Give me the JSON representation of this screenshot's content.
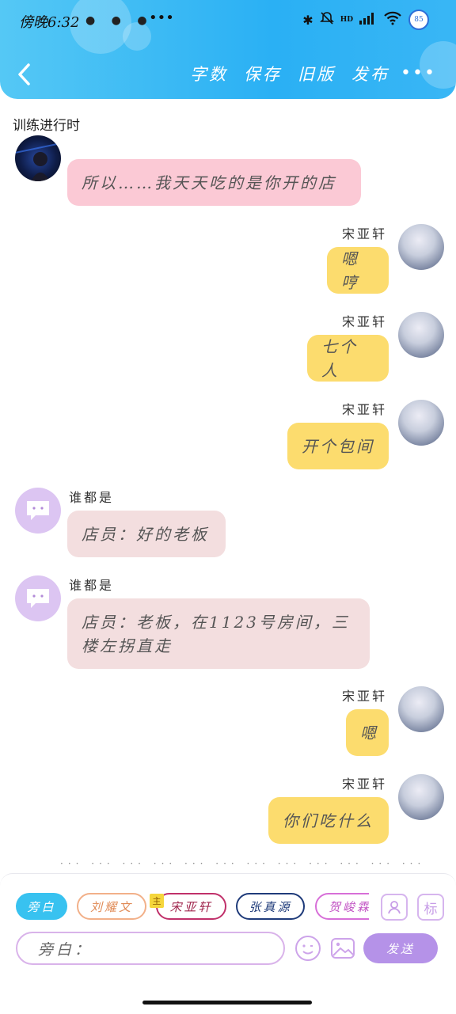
{
  "status_bar": {
    "time": "傍晚6:32",
    "dots": "● ● ●",
    "more": "•••",
    "bluetooth": "✱",
    "mute": "🔕",
    "hd": "HD",
    "signal": "▮▮▮",
    "wifi": "◠",
    "battery": "85"
  },
  "nav": {
    "back_icon": "‹",
    "actions": [
      "字数",
      "保存",
      "旧版",
      "发布"
    ],
    "more": "•••"
  },
  "section_title": "训练进行时",
  "messages": [
    {
      "side": "left",
      "sender": "",
      "text": "所以……我天天吃的是你开的店",
      "color": "pink",
      "avatar": "dark"
    },
    {
      "side": "right",
      "sender": "宋亚轩",
      "text": "嗯哼",
      "color": "yellow",
      "avatar": "photo"
    },
    {
      "side": "right",
      "sender": "宋亚轩",
      "text": "七个人",
      "color": "yellow",
      "avatar": "photo"
    },
    {
      "side": "right",
      "sender": "宋亚轩",
      "text": "开个包间",
      "color": "yellow",
      "avatar": "photo"
    },
    {
      "side": "left",
      "sender": "谁都是",
      "text": "店员：好的老板",
      "color": "rose",
      "avatar": "chat"
    },
    {
      "side": "left",
      "sender": "谁都是",
      "text": "店员：老板，在1123号房间，三\n楼左拐直走",
      "color": "rose",
      "avatar": "chat"
    },
    {
      "side": "right",
      "sender": "宋亚轩",
      "text": "嗯",
      "color": "yellow",
      "avatar": "photo"
    },
    {
      "side": "right",
      "sender": "宋亚轩",
      "text": "你们吃什么",
      "color": "yellow",
      "avatar": "photo"
    }
  ],
  "typing_dots": "··· ··· ··· ··· ··· ··· ··· ··· ··· ··· ··· ··· ··· ··· ··· ··· ··· ···",
  "roles": [
    {
      "label": "旁白",
      "active": true
    },
    {
      "label": "刘耀文"
    },
    {
      "label": "宋亚轩",
      "tag": "主"
    },
    {
      "label": "张真源"
    },
    {
      "label": "贺峻霖"
    }
  ],
  "role_tool_1": "☺",
  "role_tool_2": "标",
  "input": {
    "value": "旁白："
  },
  "emoji_icon": "☺",
  "image_icon": "▣",
  "send_label": "发送",
  "colors": {
    "header": "#2ab0f4",
    "pink_bubble": "#fbc9d5",
    "yellow_bubble": "#fcdc6e",
    "rose_bubble": "#f3dedf",
    "send_button": "#b592e8"
  }
}
